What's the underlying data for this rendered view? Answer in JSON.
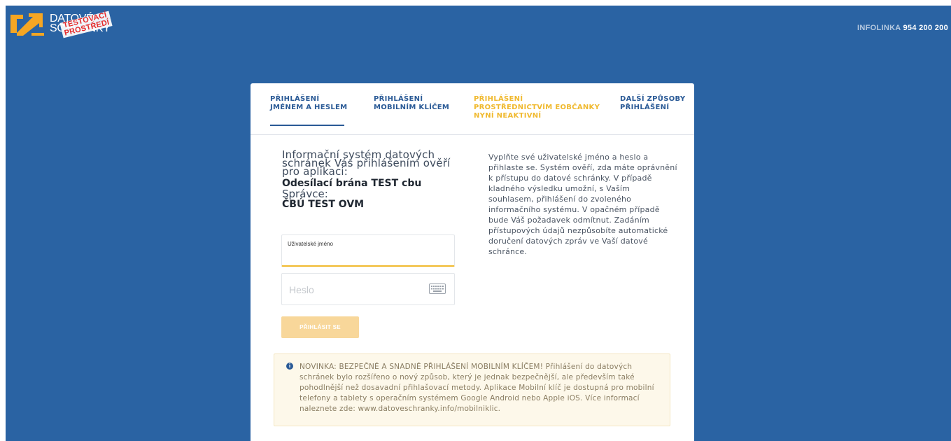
{
  "header": {
    "logo": {
      "line1": "DATOVÉ",
      "line2": "SCHRÁNKY",
      "stamp_line1": "TESTOVACÍ",
      "stamp_line2": "PROSTŘEDÍ"
    },
    "infolinka_label": "INFOLINKA",
    "infolinka_number": "954 200 200"
  },
  "tabs": [
    {
      "line1": "PŘIHLÁŠENÍ",
      "line2": "JMÉNEM A HESLEM",
      "line3": "",
      "active": true,
      "disabled": false
    },
    {
      "line1": "PŘIHLÁŠENÍ",
      "line2": "MOBILNÍM KLÍČEM",
      "line3": "",
      "active": false,
      "disabled": false
    },
    {
      "line1": "PŘIHLÁŠENÍ",
      "line2": "PROSTŘEDNICTVÍM eOBČANKY",
      "line3": "NYNÍ NEAKTIVNÍ",
      "active": false,
      "disabled": true
    },
    {
      "line1": "DALŠÍ ZPŮSOBY",
      "line2": "PŘIHLÁŠENÍ",
      "line3": "",
      "active": false,
      "disabled": false
    }
  ],
  "info": {
    "intro": "Informační systém datových schránek Vás přihlášením ověří pro aplikaci:",
    "app_name": "Odesílací brána TEST cbu",
    "spravce_label": "Správce:",
    "spravce_name": "ČBÚ TEST OVM"
  },
  "description": "Vyplňte své uživatelské jméno a heslo a přihlaste se. Systém ověří, zda máte oprávnění k přístupu do datové schránky. V případě kladného výsledku umožní, s Vaším souhlasem, přihlášení do zvoleného informačního systému. V opačném případě bude Váš požadavek odmítnut. Zadáním přístupových údajů nezpůsobíte automatické doručení datových zpráv ve Vaší datové schránce.",
  "form": {
    "username_label": "Uživatelské jméno",
    "username_value": "",
    "password_placeholder": "Heslo",
    "password_value": "",
    "login_button": "PŘIHLÁSIT SE"
  },
  "notice": {
    "text": "NOVINKA: BEZPEČNÉ A SNADNÉ PŘIHLÁŠENÍ MOBILNÍM KLÍČEM! Přihlášení do datových schránek bylo rozšířeno o nový způsob, který je jednak bezpečnější, ale především také pohodlnější než dosavadní přihlašovací metody. Aplikace Mobilní klíč je dostupná pro mobilní telefony a tablety s operačním systémem Google Android nebo Apple iOS. Více informací naleznete zde: www.datoveschranky.info/mobilniklic."
  },
  "colors": {
    "background": "#2a63a3",
    "primary": "#2a5a96",
    "accent": "#f0b92e",
    "button_disabled": "#f8d79a",
    "notice_bg": "#fdf8ea"
  },
  "icons": {
    "logo": "arrow-logo-icon",
    "keyboard": "keyboard-icon",
    "info": "info-icon"
  }
}
